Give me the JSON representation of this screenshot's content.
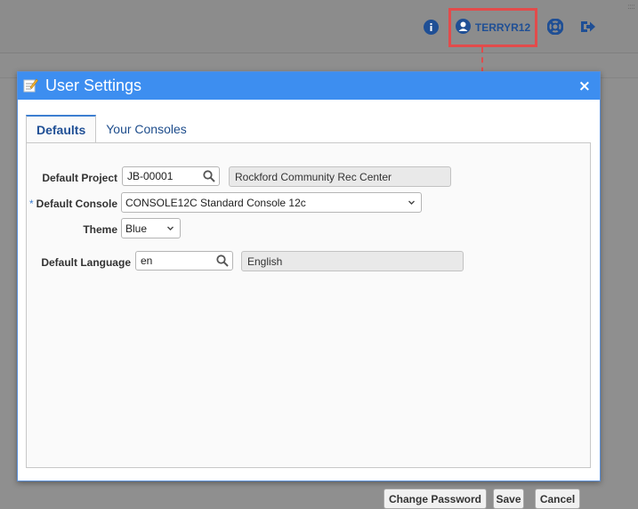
{
  "header": {
    "username": "TERRYR12",
    "icons": [
      "info-icon",
      "user-circle-icon",
      "lifebuoy-icon",
      "sign-out-icon"
    ],
    "grip": "::::"
  },
  "colors": {
    "accent": "#3d8ef0",
    "highlight": "#e24b4b",
    "link": "#1f4f95"
  },
  "dialog": {
    "title": "User Settings",
    "close_label": "×",
    "tabs": [
      {
        "label": "Defaults",
        "active": true
      },
      {
        "label": "Your Consoles",
        "active": false
      }
    ],
    "form": {
      "default_project": {
        "label": "Default Project",
        "value": "JB-00001",
        "description": "Rockford Community Rec Center"
      },
      "default_console": {
        "required_mark": "*",
        "label": "Default Console",
        "value": "CONSOLE12C Standard Console 12c"
      },
      "theme": {
        "label": "Theme",
        "value": "Blue"
      },
      "default_language": {
        "label": "Default Language",
        "value": "en",
        "description": "English"
      }
    },
    "buttons": {
      "change_password": "Change Password",
      "save": "Save",
      "cancel": "Cancel"
    }
  }
}
